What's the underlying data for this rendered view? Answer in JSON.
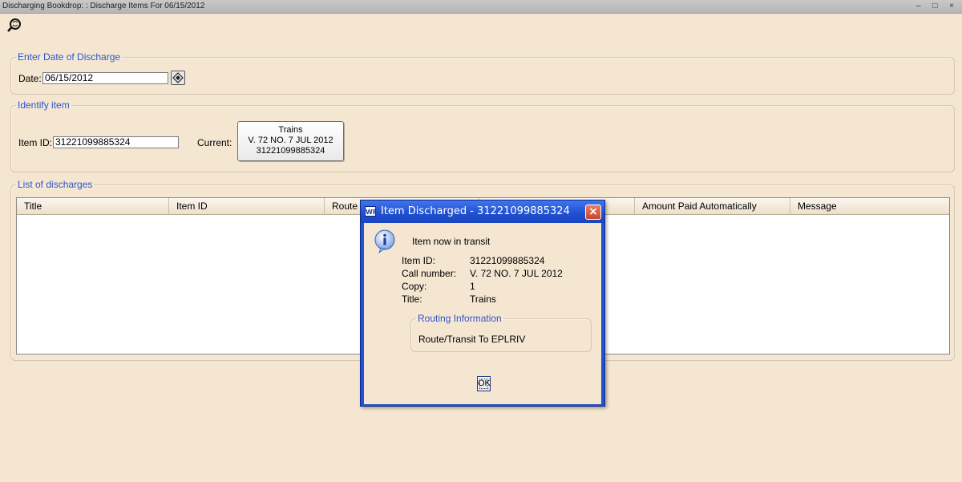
{
  "window": {
    "title": "Discharging Bookdrop: : Discharge Items For 06/15/2012",
    "controls": "– □ ×"
  },
  "toolbar": {
    "icon": "search-magnifier-icon"
  },
  "date_group": {
    "legend": "Enter Date of Discharge",
    "date_label": "Date:",
    "date_value": "06/15/2012"
  },
  "identify_group": {
    "legend": "Identify item",
    "item_id_label": "Item ID:",
    "item_id_value": "31221099885324",
    "current_label": "Current:",
    "current_lines": [
      "Trains",
      "V. 72 NO. 7 JUL 2012",
      "31221099885324"
    ]
  },
  "discharges_group": {
    "legend": "List of discharges",
    "columns": [
      "Title",
      "Item ID",
      "Route",
      "",
      "Amount Paid Automatically",
      "Message"
    ]
  },
  "dialog": {
    "app_icon_text": "WF",
    "title": "Item Discharged - 31221099885324",
    "close": "×",
    "headline": "Item now in transit",
    "fields": [
      {
        "label": "Item ID:",
        "value": "31221099885324"
      },
      {
        "label": "Call number:",
        "value": "V. 72 NO. 7 JUL 2012"
      },
      {
        "label": "Copy:",
        "value": "1"
      },
      {
        "label": "Title:",
        "value": "Trains"
      }
    ],
    "routing_legend": "Routing Information",
    "routing_text": "Route/Transit To EPLRIV",
    "ok_label": "OK"
  },
  "colors": {
    "background": "#f4e6d1",
    "legend_blue": "#2b54c9",
    "dialog_blue": "#2251d4",
    "close_red": "#d9573a"
  }
}
